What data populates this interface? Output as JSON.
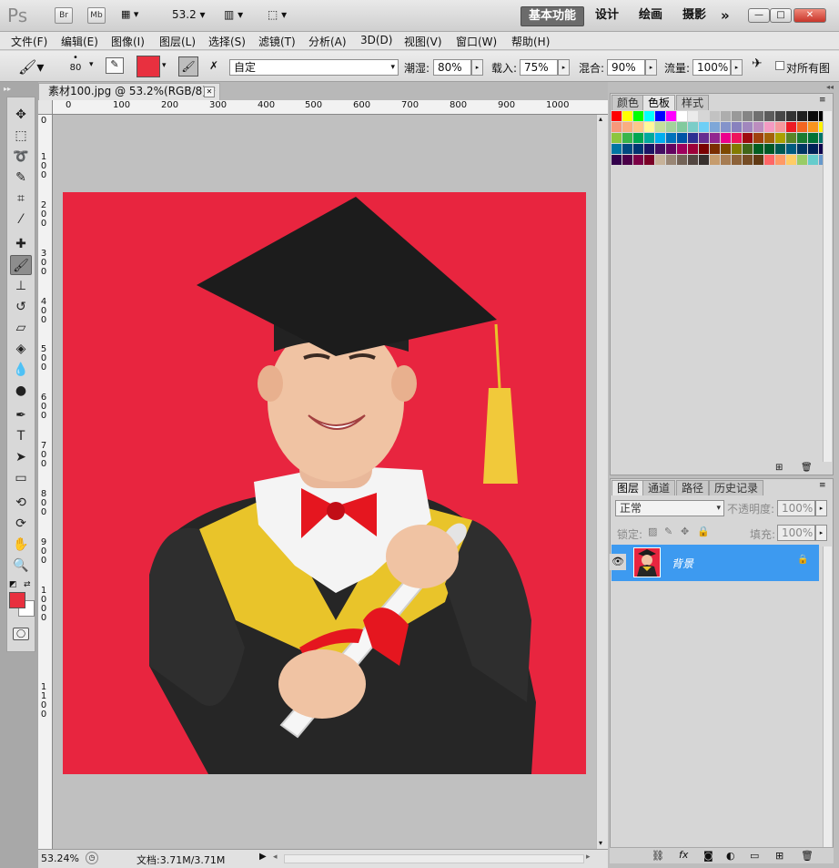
{
  "titlebar": {
    "app_logo": "Ps",
    "bridge_btn": "Br",
    "minibridge_btn": "Mb",
    "zoom_value": "53.2",
    "workspaces": [
      "基本功能",
      "设计",
      "绘画",
      "摄影"
    ],
    "more_workspaces": "»",
    "win_minimize": "—",
    "win_restore": "□",
    "win_close": "✕"
  },
  "menubar": {
    "items": [
      "文件(F)",
      "编辑(E)",
      "图像(I)",
      "图层(L)",
      "选择(S)",
      "滤镜(T)",
      "分析(A)",
      "3D(D)",
      "视图(V)",
      "窗口(W)",
      "帮助(H)"
    ]
  },
  "options": {
    "brush_size": "80",
    "foreground_color": "#e8303f",
    "mode_value": "自定",
    "wet_label": "潮湿:",
    "wet_value": "80%",
    "load_label": "载入:",
    "load_value": "75%",
    "mix_label": "混合:",
    "mix_value": "90%",
    "flow_label": "流量:",
    "flow_value": "100%",
    "sample_all_label": "对所有图"
  },
  "document": {
    "tab_title": "素材100.jpg @ 53.2%(RGB/8) *",
    "tab_close": "✕",
    "ruler_top": [
      "0",
      "100",
      "200",
      "300",
      "400",
      "500",
      "600",
      "700",
      "800",
      "900",
      "1000"
    ],
    "ruler_left": [
      "0",
      "1\n0\n0",
      "2\n0\n0",
      "3\n0\n0",
      "4\n0\n0",
      "5\n0\n0",
      "6\n0\n0",
      "7\n0\n0",
      "8\n0\n0",
      "9\n0\n0",
      "1\n0\n0\n0",
      "1\n1\n0\n0"
    ]
  },
  "status": {
    "zoom": "53.24%",
    "doc_info": "文档:3.71M/3.71M"
  },
  "tools": [
    {
      "icon": "move-icon",
      "glyph": "✥"
    },
    {
      "icon": "marquee-icon",
      "glyph": "⬚"
    },
    {
      "icon": "lasso-icon",
      "glyph": "➰"
    },
    {
      "icon": "quick-select-icon",
      "glyph": "✎"
    },
    {
      "icon": "crop-icon",
      "glyph": "⌗"
    },
    {
      "icon": "eyedropper-icon",
      "glyph": "⁄"
    },
    {
      "icon": "healing-brush-icon",
      "glyph": "✚"
    },
    {
      "icon": "mixer-brush-icon",
      "glyph": "🖌"
    },
    {
      "icon": "clone-stamp-icon",
      "glyph": "⊥"
    },
    {
      "icon": "history-brush-icon",
      "glyph": "↺"
    },
    {
      "icon": "eraser-icon",
      "glyph": "▱"
    },
    {
      "icon": "paint-bucket-icon",
      "glyph": "◈"
    },
    {
      "icon": "blur-icon",
      "glyph": "💧"
    },
    {
      "icon": "dodge-icon",
      "glyph": "●"
    },
    {
      "icon": "pen-icon",
      "glyph": "✒"
    },
    {
      "icon": "type-icon",
      "glyph": "T"
    },
    {
      "icon": "path-select-icon",
      "glyph": "➤"
    },
    {
      "icon": "shape-icon",
      "glyph": "▭"
    },
    {
      "icon": "3d-rotate-icon",
      "glyph": "⟲"
    },
    {
      "icon": "3d-orbit-icon",
      "glyph": "⟳"
    },
    {
      "icon": "hand-icon",
      "glyph": "✋"
    },
    {
      "icon": "zoom-icon",
      "glyph": "🔍"
    }
  ],
  "color_panel": {
    "tabs": [
      "颜色",
      "色板",
      "样式"
    ],
    "active_tab": "色板",
    "swatches": [
      "#ff0000",
      "#ffff00",
      "#00ff00",
      "#00ffff",
      "#0000ff",
      "#ff00ff",
      "#ffffff",
      "#ebebeb",
      "#d6d6d6",
      "#c2c2c2",
      "#adadad",
      "#999999",
      "#858585",
      "#707070",
      "#5c5c5c",
      "#474747",
      "#333333",
      "#1f1f1f",
      "#0a0a0a",
      "#000000",
      "#f7977a",
      "#f9ad81",
      "#fdc68a",
      "#fff79a",
      "#c4df9b",
      "#a3d39c",
      "#82ca9d",
      "#7bcdc8",
      "#6ecff6",
      "#7ea7d8",
      "#8493ca",
      "#8882be",
      "#a187be",
      "#bc8dbf",
      "#f49ac2",
      "#f6989d",
      "#ed1c24",
      "#f26522",
      "#f7941d",
      "#fff200",
      "#8dc63f",
      "#39b54a",
      "#00a651",
      "#00a99d",
      "#00aeef",
      "#0072bc",
      "#0054a6",
      "#2e3192",
      "#662d91",
      "#92278f",
      "#ec008c",
      "#ed145b",
      "#9e0b0f",
      "#a0410d",
      "#a36209",
      "#aba000",
      "#598527",
      "#197b30",
      "#007236",
      "#00746b",
      "#0076a3",
      "#004a80",
      "#003471",
      "#1b1464",
      "#440e62",
      "#630460",
      "#9e005d",
      "#9e0039",
      "#790000",
      "#7b2e00",
      "#7d4900",
      "#827b00",
      "#406618",
      "#005e20",
      "#005826",
      "#005952",
      "#005b7f",
      "#003663",
      "#002157",
      "#0d004c",
      "#32004b",
      "#4b0049",
      "#7b0046",
      "#7a0026",
      "#c7b299",
      "#998675",
      "#736357",
      "#534741",
      "#37302d",
      "#c69c6d",
      "#a67c52",
      "#8c6239",
      "#754c24",
      "#603913",
      "#ff6666",
      "#ff9966",
      "#ffcc66",
      "#99cc66",
      "#66cccc",
      "#6699cc"
    ]
  },
  "layers_panel": {
    "tabs": [
      "图层",
      "通道",
      "路径",
      "历史记录"
    ],
    "active_tab": "图层",
    "blend_mode": "正常",
    "opacity_label": "不透明度:",
    "opacity_value": "100%",
    "lock_label": "锁定:",
    "fill_label": "填充:",
    "fill_value": "100%",
    "layer_name": "背景"
  }
}
